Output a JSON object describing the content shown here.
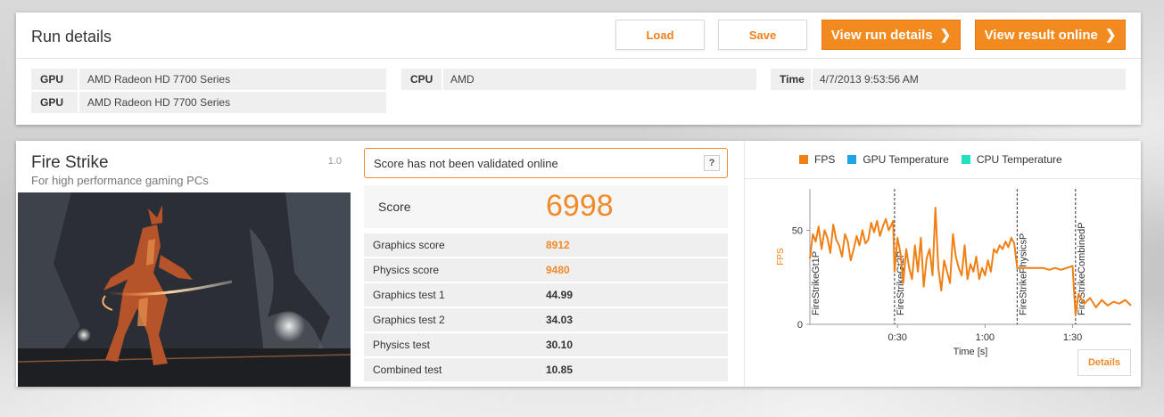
{
  "run_details": {
    "title": "Run details",
    "buttons": {
      "load": "Load",
      "save": "Save",
      "view_run_details": "View run details",
      "view_result_online": "View result online"
    },
    "gpu_rows": [
      {
        "key": "GPU",
        "value": "AMD Radeon HD 7700 Series"
      },
      {
        "key": "GPU",
        "value": "AMD Radeon HD 7700 Series"
      }
    ],
    "cpu": {
      "key": "CPU",
      "value": "AMD"
    },
    "time": {
      "key": "Time",
      "value": "4/7/2013 9:53:56 AM"
    }
  },
  "test": {
    "name": "Fire Strike",
    "subtitle": "For high performance gaming PCs",
    "version": "1.0",
    "validation_message": "Score has not been validated online",
    "help_label": "?",
    "score_label": "Score",
    "score_value": "6998",
    "details": [
      {
        "label": "Graphics score",
        "value": "8912",
        "highlight": true
      },
      {
        "label": "Physics score",
        "value": "9480",
        "highlight": true
      },
      {
        "label": "Graphics test 1",
        "value": "44.99",
        "highlight": false
      },
      {
        "label": "Graphics test 2",
        "value": "34.03",
        "highlight": false
      },
      {
        "label": "Physics test",
        "value": "30.10",
        "highlight": false
      },
      {
        "label": "Combined test",
        "value": "10.85",
        "highlight": false
      }
    ]
  },
  "colors": {
    "accent_orange": "#f38a1f",
    "fps": "#f07f14",
    "gpu_temperature": "#1da5e6",
    "cpu_temperature": "#22e0c0"
  },
  "chart_data": {
    "type": "line",
    "legend": [
      "FPS",
      "GPU Temperature",
      "CPU Temperature"
    ],
    "ylabel": "FPS",
    "xlabel": "Time [s]",
    "y_ticks": [
      "0",
      "50"
    ],
    "x_ticks": [
      "0:30",
      "1:00",
      "1:30"
    ],
    "ylim": [
      0,
      72
    ],
    "xlim": [
      0,
      110
    ],
    "sections": [
      {
        "name": "FireStrikeGt1P",
        "start": 0
      },
      {
        "name": "FireStrikeGt2P",
        "start": 29
      },
      {
        "name": "FireStrikePhysicsP",
        "start": 71
      },
      {
        "name": "FireStrikeCombinedP",
        "start": 91
      }
    ],
    "series": [
      {
        "name": "FPS",
        "x": [
          0,
          1,
          2,
          3,
          4,
          5,
          6,
          7,
          8,
          9,
          10,
          11,
          12,
          13,
          14,
          15,
          16,
          17,
          18,
          19,
          20,
          21,
          22,
          23,
          24,
          25,
          26,
          27,
          28,
          28.5,
          29,
          30,
          31,
          32,
          33,
          34,
          35,
          36,
          37,
          38,
          39,
          40,
          41,
          42,
          43,
          44,
          45,
          46,
          47,
          48,
          49,
          50,
          51,
          52,
          53,
          54,
          55,
          56,
          57,
          58,
          59,
          60,
          61,
          62,
          63,
          64,
          65,
          66,
          67,
          68,
          69,
          70,
          71,
          72,
          74,
          76,
          78,
          80,
          82,
          84,
          86,
          88,
          90,
          91,
          92,
          94,
          96,
          98,
          100,
          102,
          104,
          106,
          108,
          110
        ],
        "values": [
          35,
          48,
          44,
          52,
          40,
          50,
          46,
          38,
          53,
          45,
          42,
          36,
          48,
          44,
          34,
          40,
          47,
          42,
          50,
          43,
          45,
          54,
          49,
          55,
          47,
          52,
          56,
          50,
          53,
          55,
          28,
          46,
          38,
          22,
          40,
          30,
          24,
          42,
          28,
          46,
          20,
          35,
          40,
          26,
          62,
          30,
          18,
          34,
          28,
          22,
          48,
          36,
          30,
          26,
          42,
          24,
          32,
          28,
          36,
          24,
          30,
          26,
          34,
          28,
          40,
          38,
          42,
          40,
          44,
          41,
          46,
          43,
          30,
          30,
          30,
          30,
          30,
          30,
          29,
          30,
          29,
          30,
          31,
          5,
          16,
          11,
          14,
          9,
          13,
          10,
          12,
          11,
          13,
          10
        ]
      }
    ]
  }
}
